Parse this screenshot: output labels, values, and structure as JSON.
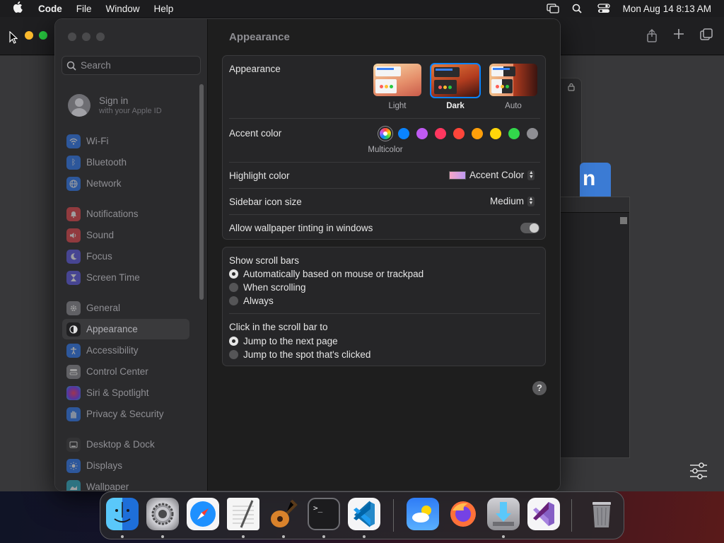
{
  "menubar": {
    "app_name": "Code",
    "items": [
      "File",
      "Window",
      "Help"
    ],
    "clock": "Mon Aug 14  8:13 AM"
  },
  "sidebar": {
    "search_placeholder": "Search",
    "signin_title": "Sign in",
    "signin_subtitle": "with your Apple ID",
    "items": [
      {
        "label": "Wi-Fi",
        "icon": "wifi-icon",
        "color": "#2f7cf6"
      },
      {
        "label": "Bluetooth",
        "icon": "bluetooth-icon",
        "color": "#2f7cf6"
      },
      {
        "label": "Network",
        "icon": "globe-icon",
        "color": "#2f7cf6"
      },
      {
        "label": "Notifications",
        "icon": "bell-icon",
        "color": "#e5484d"
      },
      {
        "label": "Sound",
        "icon": "speaker-icon",
        "color": "#e5484d"
      },
      {
        "label": "Focus",
        "icon": "moon-icon",
        "color": "#5e5ce6"
      },
      {
        "label": "Screen Time",
        "icon": "hourglass-icon",
        "color": "#5e5ce6"
      },
      {
        "label": "General",
        "icon": "gear-icon",
        "color": "#8e8e93"
      },
      {
        "label": "Appearance",
        "icon": "appearance-icon",
        "color": "#2c2c2e"
      },
      {
        "label": "Accessibility",
        "icon": "accessibility-icon",
        "color": "#2f7cf6"
      },
      {
        "label": "Control Center",
        "icon": "control-center-icon",
        "color": "#8e8e93"
      },
      {
        "label": "Siri & Spotlight",
        "icon": "siri-icon",
        "color": "#c042d6"
      },
      {
        "label": "Privacy & Security",
        "icon": "hand-icon",
        "color": "#2f7cf6"
      },
      {
        "label": "Desktop & Dock",
        "icon": "dock-icon",
        "color": "#3a3a3c"
      },
      {
        "label": "Displays",
        "icon": "sun-icon",
        "color": "#2f7cf6"
      },
      {
        "label": "Wallpaper",
        "icon": "wallpaper-icon",
        "color": "#30b0c7"
      }
    ]
  },
  "main": {
    "title": "Appearance",
    "appearance": {
      "label": "Appearance",
      "options": [
        "Light",
        "Dark",
        "Auto"
      ],
      "selected": "Dark"
    },
    "accent": {
      "label": "Accent color",
      "colors": [
        "multicolor",
        "#0a84ff",
        "#bf5af2",
        "#ff375f",
        "#ff453a",
        "#ff9f0a",
        "#ffd60a",
        "#32d74b",
        "#8e8e93"
      ],
      "selected_name": "Multicolor"
    },
    "highlight": {
      "label": "Highlight color",
      "value": "Accent Color"
    },
    "sidebar_icon_size": {
      "label": "Sidebar icon size",
      "value": "Medium"
    },
    "wallpaper_tinting": {
      "label": "Allow wallpaper tinting in windows",
      "enabled": false
    },
    "scroll_bars": {
      "label": "Show scroll bars",
      "options": [
        "Automatically based on mouse or trackpad",
        "When scrolling",
        "Always"
      ],
      "selected": 0
    },
    "click_scroll": {
      "label": "Click in the scroll bar to",
      "options": [
        "Jump to the next page",
        "Jump to the spot that's clicked"
      ],
      "selected": 0
    },
    "help": "?"
  },
  "dock": {
    "apps": [
      "Finder",
      "System Settings",
      "Safari",
      "TextEdit",
      "GarageBand",
      "Terminal",
      "Visual Studio Code",
      "Weather",
      "Firefox",
      "Migration Assistant",
      "Visual Studio",
      "Trash"
    ]
  }
}
